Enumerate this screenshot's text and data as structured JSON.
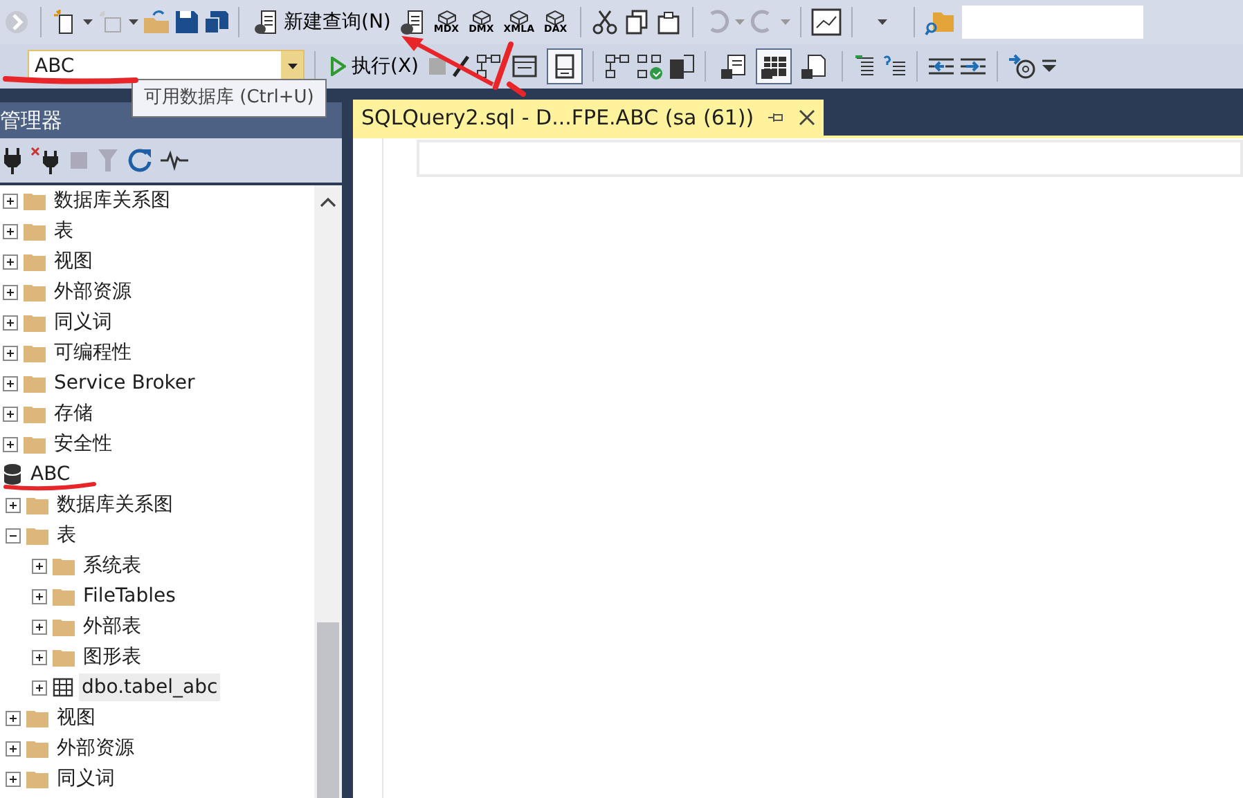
{
  "toolbar1": {
    "new_query": "新建查询(N)",
    "cube_labels": [
      "MDX",
      "DMX",
      "XMLA",
      "DAX"
    ]
  },
  "toolbar2": {
    "database": "ABC",
    "execute": "执行(X)",
    "layout_buttons": [
      {
        "pressed": false
      },
      {
        "pressed": true
      }
    ],
    "result_buttons": [
      {
        "pressed": false
      },
      {
        "pressed": true
      },
      {
        "pressed": false
      }
    ]
  },
  "tooltip": "可用数据库 (Ctrl+U)",
  "explorer": {
    "title": "管理器",
    "tree": [
      {
        "kind": "folder",
        "label": "数据库关系图",
        "expanded": false,
        "selected": false
      },
      {
        "kind": "folder",
        "label": "表",
        "expanded": false,
        "selected": false
      },
      {
        "kind": "folder",
        "label": "视图",
        "expanded": false,
        "selected": false
      },
      {
        "kind": "folder",
        "label": "外部资源",
        "expanded": false,
        "selected": false
      },
      {
        "kind": "folder",
        "label": "同义词",
        "expanded": false,
        "selected": false
      },
      {
        "kind": "folder",
        "label": "可编程性",
        "expanded": false,
        "selected": false
      },
      {
        "kind": "folder",
        "label": "Service Broker",
        "expanded": false,
        "selected": false
      },
      {
        "kind": "folder",
        "label": "存储",
        "expanded": false,
        "selected": false
      },
      {
        "kind": "folder",
        "label": "安全性",
        "expanded": false,
        "selected": false
      },
      {
        "kind": "database",
        "label": "ABC",
        "expanded": true,
        "selected": false,
        "children": [
          {
            "kind": "folder",
            "label": "数据库关系图",
            "expanded": false,
            "selected": false
          },
          {
            "kind": "folder",
            "label": "表",
            "expanded": true,
            "selected": false,
            "children": [
              {
                "kind": "folder",
                "label": "系统表",
                "expanded": false,
                "selected": false
              },
              {
                "kind": "folder",
                "label": "FileTables",
                "expanded": false,
                "selected": false
              },
              {
                "kind": "folder",
                "label": "外部表",
                "expanded": false,
                "selected": false
              },
              {
                "kind": "folder",
                "label": "图形表",
                "expanded": false,
                "selected": false
              },
              {
                "kind": "table",
                "label": "dbo.tabel_abc",
                "expanded": false,
                "selected": true
              }
            ]
          },
          {
            "kind": "folder",
            "label": "视图",
            "expanded": false,
            "selected": false
          },
          {
            "kind": "folder",
            "label": "外部资源",
            "expanded": false,
            "selected": false
          },
          {
            "kind": "folder",
            "label": "同义词",
            "expanded": false,
            "selected": false
          }
        ]
      }
    ]
  },
  "editor_tab": {
    "title": "SQLQuery2.sql - D...FPE.ABC (sa (61))",
    "selected": true
  }
}
